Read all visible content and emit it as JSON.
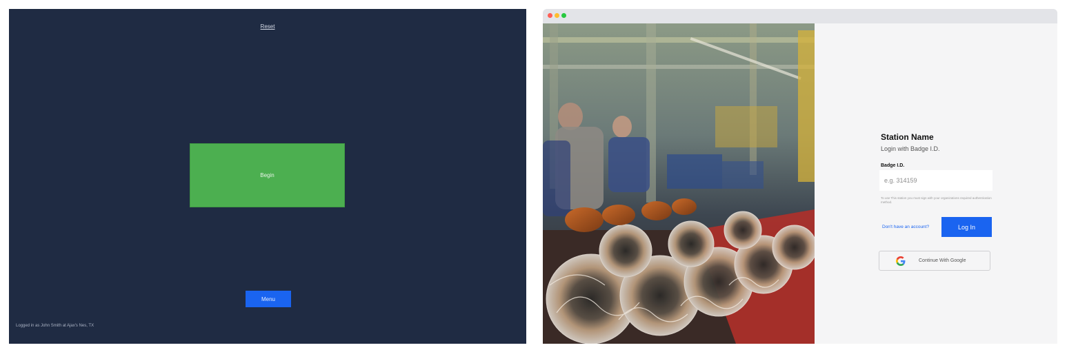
{
  "left_panel": {
    "title": "Reset",
    "begin_label": "Begin",
    "menu_label": "Menu",
    "logged_in_text": "Logged in as John Smith at Ajax's Nes, TX"
  },
  "login_window": {
    "station_name": "Station Name",
    "subtitle": "Login with Badge I.D.",
    "badge_label": "Badge I.D.",
    "badge_placeholder": "e.g. 314159",
    "badge_value": "",
    "helper_text": "To use This station you must sign with your organizations required authentication method.",
    "signup_link": "Don't have an account?",
    "login_button": "Log In",
    "google_button": "Continue With Google"
  },
  "icons": {
    "window_controls": [
      "close-dot",
      "minimize-dot",
      "maximize-dot"
    ],
    "google": "google-g-icon"
  },
  "colors": {
    "left_background": "#1f2b43",
    "begin_button": "#4caf50",
    "primary_blue": "#1a64f0"
  }
}
